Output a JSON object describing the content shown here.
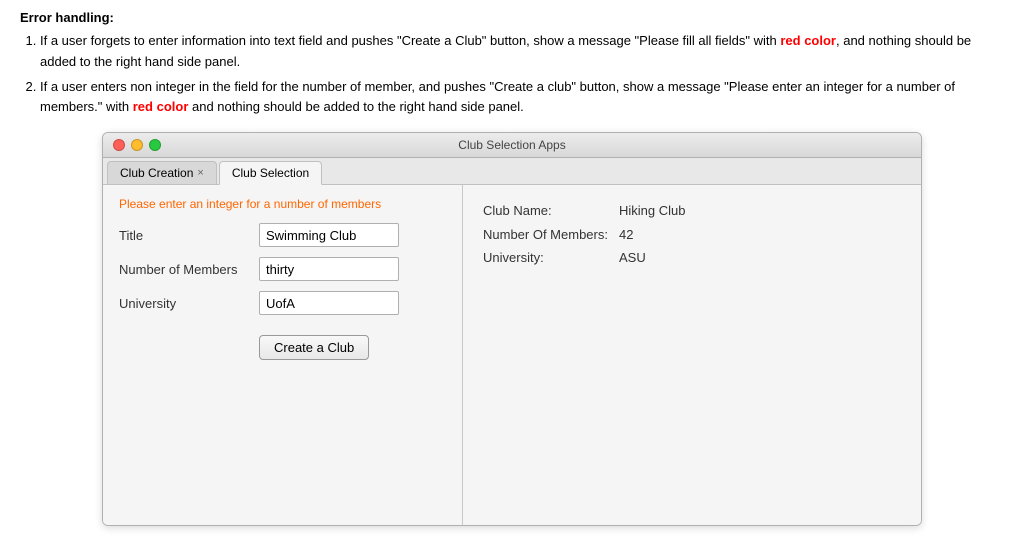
{
  "page": {
    "error_section": {
      "title": "Error handling:",
      "items": [
        {
          "text_before": "If a user forgets to enter information into text field and pushes \"Create a Club\" button, show a message \"Please fill all fields\" with ",
          "bold_red": "red color",
          "text_after": ", and nothing should be added to the right hand side panel."
        },
        {
          "text_before": "If a user enters non integer in the field for the number of member, and pushes \"Create a club\" button, show a message \"Please enter an integer for a number of members.\" with ",
          "bold_red": "red color",
          "text_after": " and nothing should be added to the right hand side panel."
        }
      ]
    },
    "window": {
      "title": "Club Selection Apps",
      "tabs": [
        {
          "label": "Club Creation",
          "closeable": true,
          "active": false
        },
        {
          "label": "Club Selection",
          "closeable": false,
          "active": true
        }
      ],
      "left_panel": {
        "error_message": "Please enter an integer for a number of members",
        "form": {
          "fields": [
            {
              "label": "Title",
              "value": "Swimming Club",
              "placeholder": ""
            },
            {
              "label": "Number of Members",
              "value": "thirty",
              "placeholder": ""
            },
            {
              "label": "University",
              "value": "UofA",
              "placeholder": ""
            }
          ],
          "button_label": "Create a Club"
        }
      },
      "right_panel": {
        "clubs": [
          {
            "name_label": "Club Name:",
            "name_value": "Hiking Club",
            "members_label": "Number Of Members:",
            "members_value": "42",
            "university_label": "University:",
            "university_value": "ASU"
          }
        ]
      }
    }
  }
}
